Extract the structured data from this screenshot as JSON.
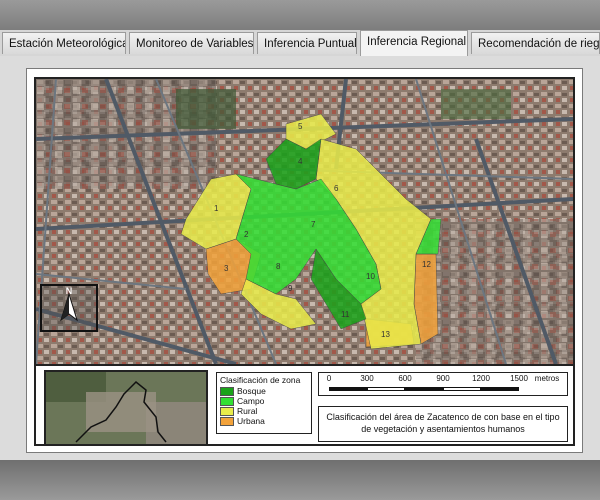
{
  "tabs": [
    {
      "label": "Estación Meteorológica",
      "active": false
    },
    {
      "label": "Monitoreo de Variables",
      "active": false
    },
    {
      "label": "Inferencia Puntual",
      "active": false
    },
    {
      "label": "Inferencia Regional",
      "active": true
    },
    {
      "label": "Recomendación de riego",
      "active": false
    }
  ],
  "map": {
    "north_label": "N",
    "zone_numbers": [
      "1",
      "2",
      "3",
      "4",
      "5",
      "6",
      "7",
      "8",
      "9",
      "10",
      "11",
      "12",
      "13"
    ]
  },
  "legend": {
    "title": "Clasificación de zona",
    "items": [
      {
        "label": "Bosque",
        "color": "#1aa31a"
      },
      {
        "label": "Campo",
        "color": "#33e033"
      },
      {
        "label": "Rural",
        "color": "#e9ec4a"
      },
      {
        "label": "Urbana",
        "color": "#f2a23a"
      }
    ]
  },
  "scale": {
    "ticks": [
      "0",
      "300",
      "600",
      "900",
      "1200",
      "1500"
    ],
    "unit": "metros"
  },
  "caption": {
    "line1": "Clasificación del área de Zacatenco de con base en el tipo",
    "line2": "de vegetación y asentamientos humanos"
  }
}
